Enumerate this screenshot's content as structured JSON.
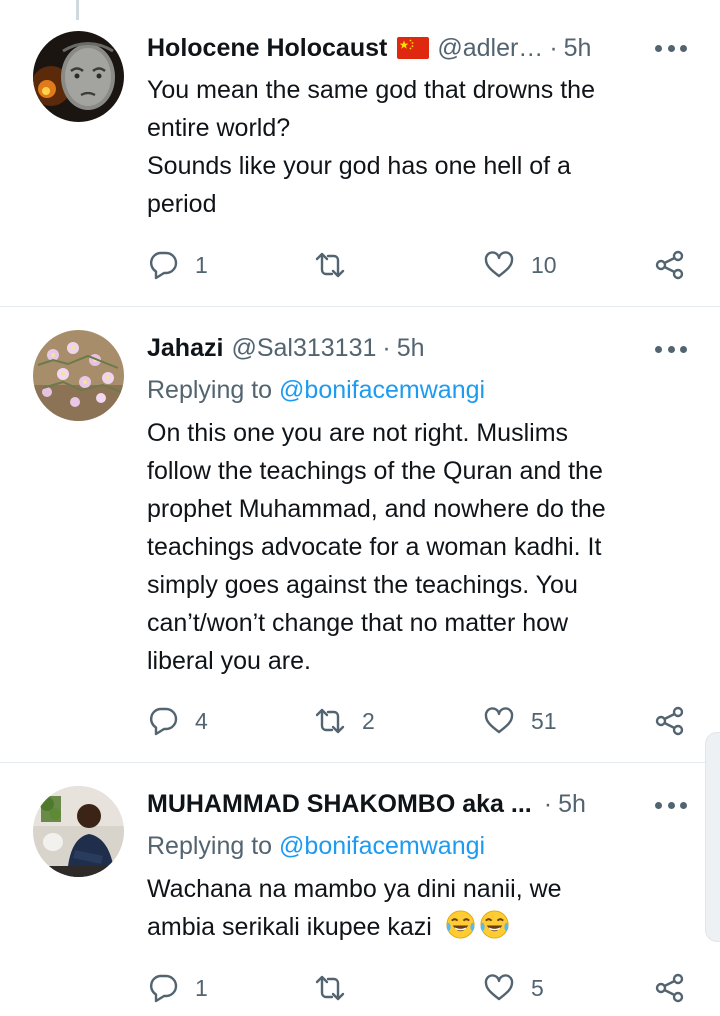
{
  "tweets": [
    {
      "name": "Holocene Holocaust",
      "handle": "@adler…",
      "time": "5h",
      "has_flag": true,
      "reply_prefix": "",
      "reply_mention": "",
      "lines": [
        "You mean the same god that drowns the",
        "entire world?",
        "Sounds like your god has one hell of a",
        "period"
      ],
      "replies": "1",
      "retweets": "",
      "likes": "10"
    },
    {
      "name": "Jahazi",
      "handle": "@Sal313131",
      "time": "5h",
      "has_flag": false,
      "reply_prefix": "Replying to",
      "reply_mention": "@bonifacemwangi",
      "lines": [
        "On this one you are not right. Muslims",
        "follow the teachings of the Quran and the",
        "prophet Muhammad, and nowhere do the",
        "teachings advocate for a woman kadhi. It",
        "simply goes against the teachings. You",
        "can’t/won’t change that no matter how",
        "liberal you are."
      ],
      "replies": "4",
      "retweets": "2",
      "likes": "51"
    },
    {
      "name": "MUHAMMAD SHAKOMBO aka ...",
      "handle": "",
      "time": "5h",
      "has_flag": false,
      "reply_prefix": "Replying to",
      "reply_mention": "@bonifacemwangi",
      "lines": [
        "Wachana na mambo ya dini nanii, we",
        "ambia serikali ikupee kazi"
      ],
      "emoji": [
        "face-with-tears-of-joy",
        "face-with-tears-of-joy"
      ],
      "replies": "1",
      "retweets": "",
      "likes": "5"
    }
  ],
  "colors": {
    "text": "#0f1419",
    "secondary": "#536471",
    "link": "#1d9bf0",
    "divider": "#e6ecf0"
  },
  "icons": {
    "reply": "speech-bubble-icon",
    "retweet": "retweet-icon",
    "like": "heart-icon",
    "share": "share-icon",
    "more": "more-dots-icon"
  }
}
